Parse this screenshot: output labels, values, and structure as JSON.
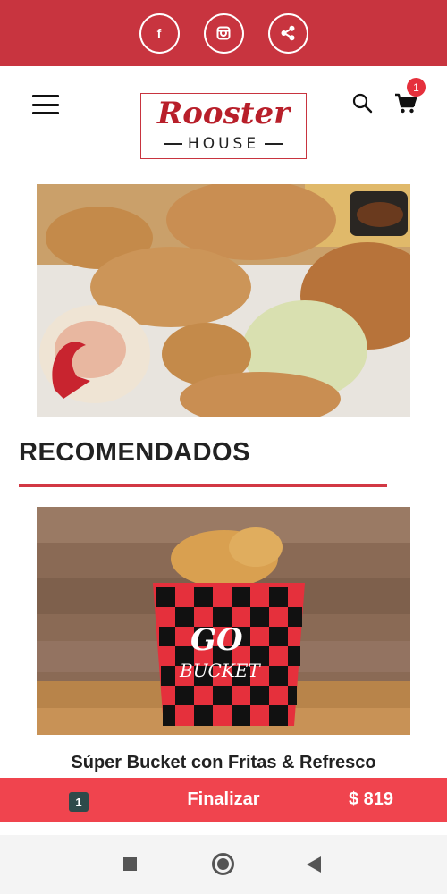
{
  "social": {
    "items": [
      {
        "icon": "facebook-icon",
        "glyph": "f"
      },
      {
        "icon": "instagram-icon"
      },
      {
        "icon": "share-icon"
      }
    ]
  },
  "header": {
    "logo": {
      "word": "Rooster",
      "sub": "HOUSE"
    },
    "cart_count": "1"
  },
  "hero": {
    "icon": "fried-chicken-photo"
  },
  "section": {
    "title": "RECOMENDADOS"
  },
  "product": {
    "name": "Súper Bucket con Fritas & Refresco",
    "bucket_text_1": "GO",
    "bucket_text_2": "BUCKET"
  },
  "checkout": {
    "qty": "1",
    "label": "Finalizar",
    "total": "$ 819"
  },
  "colors": {
    "brand_red": "#c8343f",
    "checkout_red": "#f0444e",
    "badge_red": "#e5303c",
    "qty_badge": "#2e4a4a"
  }
}
